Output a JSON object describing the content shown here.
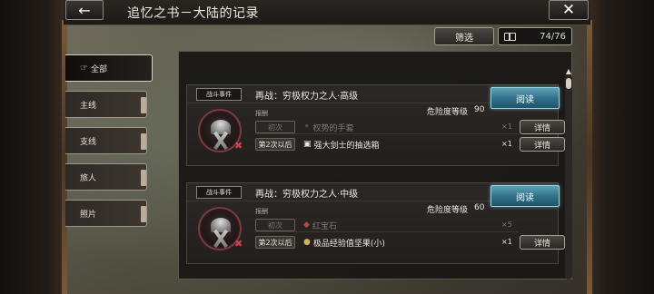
{
  "header": {
    "title": "追忆之书－大陆的记录",
    "back_icon": "arrow-left-icon",
    "close_icon": "close-icon"
  },
  "toolbar": {
    "filter_label": "筛选",
    "count": "74/76"
  },
  "tabs": [
    {
      "label": "全部",
      "active": true
    },
    {
      "label": "主线",
      "active": false
    },
    {
      "label": "支线",
      "active": false
    },
    {
      "label": "旅人",
      "active": false
    },
    {
      "label": "照片",
      "active": false
    }
  ],
  "events": [
    {
      "tag": "战斗事件",
      "title": "再战：穷极权力之人·高级",
      "read_label": "阅读",
      "reward_label": "报酬",
      "danger_label": "危险度等级",
      "danger_value": "90",
      "rewards": [
        {
          "tier": "初次",
          "item": "权势的手套",
          "icon": "bulb-icon",
          "qty": "×1",
          "claimed": true,
          "detail": "详情"
        },
        {
          "tier": "第2次以后",
          "item": "强大剑士的抽选箱",
          "icon": "chest-icon",
          "qty": "×1",
          "claimed": false,
          "detail": "详情"
        }
      ]
    },
    {
      "tag": "战斗事件",
      "title": "再战：穷极权力之人·中级",
      "read_label": "阅读",
      "reward_label": "报酬",
      "danger_label": "危险度等级",
      "danger_value": "60",
      "rewards": [
        {
          "tier": "初次",
          "item": "红宝石",
          "icon": "gem-icon",
          "qty": "×5",
          "claimed": true,
          "detail": ""
        },
        {
          "tier": "第2次以后",
          "item": "极品经验值坚果(小)",
          "icon": "nut-icon",
          "qty": "×1",
          "claimed": false,
          "detail": "详情"
        }
      ]
    }
  ]
}
